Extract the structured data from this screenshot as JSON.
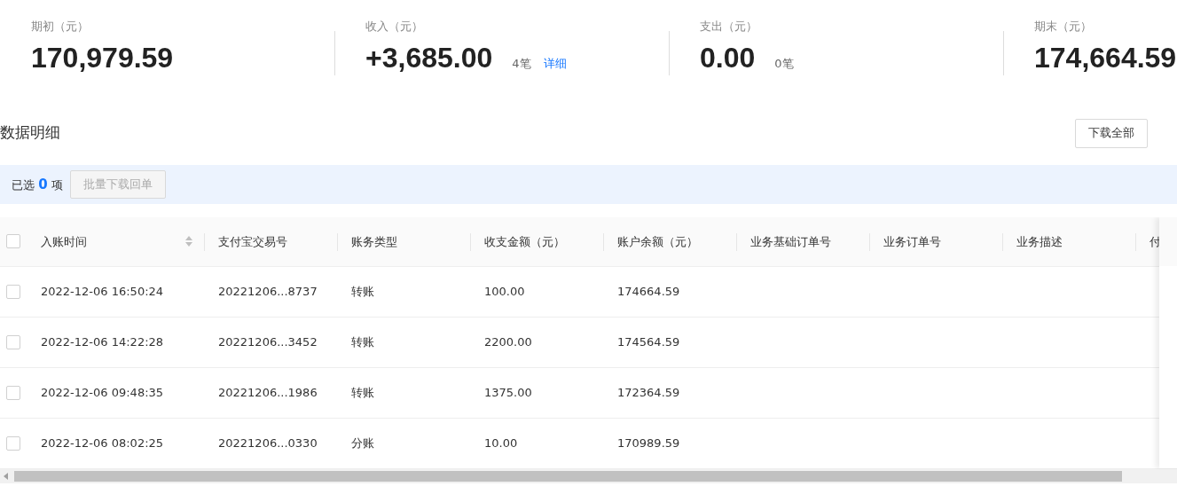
{
  "summary": [
    {
      "label": "期初（元）",
      "value": "170,979.59"
    },
    {
      "label": "收入（元）",
      "value": "+3,685.00",
      "count": "4笔",
      "link": "详细"
    },
    {
      "label": "支出（元）",
      "value": "0.00",
      "count": "0笔"
    },
    {
      "label": "期末（元）",
      "value": "174,664.59"
    }
  ],
  "section_title": "数据明细",
  "download_buttons": [
    "下载全部"
  ],
  "selection": {
    "prefix": "已选",
    "count": "0",
    "suffix": "项",
    "batch_button": "批量下载回单",
    "batch_disabled": true
  },
  "table": {
    "header_checked": false,
    "columns": [
      {
        "label": "入账时间",
        "sortable": true
      },
      {
        "label": "支付宝交易号"
      },
      {
        "label": "账务类型"
      },
      {
        "label": "收支金额（元）"
      },
      {
        "label": "账户余额（元）"
      },
      {
        "label": "业务基础订单号"
      },
      {
        "label": "业务订单号"
      },
      {
        "label": "业务描述"
      },
      {
        "label": "付"
      }
    ],
    "rows": [
      {
        "checked": false,
        "cells": [
          "2022-12-06 16:50:24",
          "20221206...8737",
          "转账",
          "100.00",
          "174664.59"
        ]
      },
      {
        "checked": false,
        "cells": [
          "2022-12-06 14:22:28",
          "20221206...3452",
          "转账",
          "2200.00",
          "174564.59"
        ]
      },
      {
        "checked": false,
        "cells": [
          "2022-12-06 09:48:35",
          "20221206...1986",
          "转账",
          "1375.00",
          "172364.59"
        ]
      },
      {
        "checked": false,
        "cells": [
          "2022-12-06 08:02:25",
          "20221206...0330",
          "分账",
          "10.00",
          "170989.59"
        ]
      }
    ]
  }
}
